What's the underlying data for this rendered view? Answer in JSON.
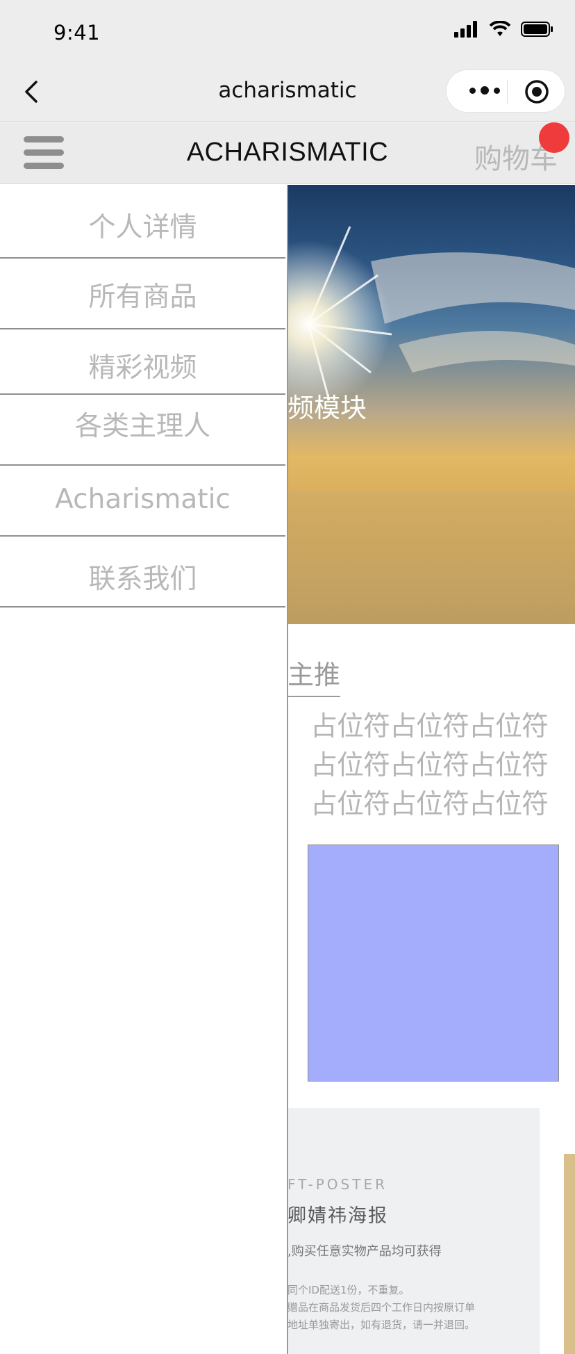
{
  "status_bar": {
    "time": "9:41"
  },
  "nav": {
    "title": "acharismatic"
  },
  "app_header": {
    "brand": "ACHARISMATIC",
    "cart_label": "购物车"
  },
  "banner": {
    "overlay_text": "频模块"
  },
  "section": {
    "title": "主推",
    "placeholder_lines": [
      "占位符占位符占位符",
      "占位符占位符占位符",
      "占位符占位符占位符"
    ]
  },
  "poster": {
    "eyebrow": "FT-POSTER",
    "title": "卿婧祎海报",
    "subtitle": ",购买任意实物产品均可获得",
    "note_lines": [
      "同个ID配送1份，不重复。",
      "赠品在商品发货后四个工作日内按原订单",
      "地址单独寄出，如有退货，请一并退回。"
    ]
  },
  "drawer": {
    "items": [
      {
        "label": "个人详情"
      },
      {
        "label": "所有商品"
      },
      {
        "label": "精彩视频"
      },
      {
        "label": "各类主理人"
      },
      {
        "label": "Acharismatic"
      },
      {
        "label": "联系我们"
      }
    ]
  },
  "colors": {
    "badge": "#ef3b3b",
    "placeholder_box": "#a3adfc",
    "menu_text": "#b8b8b8",
    "header_bg": "#ebebeb"
  }
}
